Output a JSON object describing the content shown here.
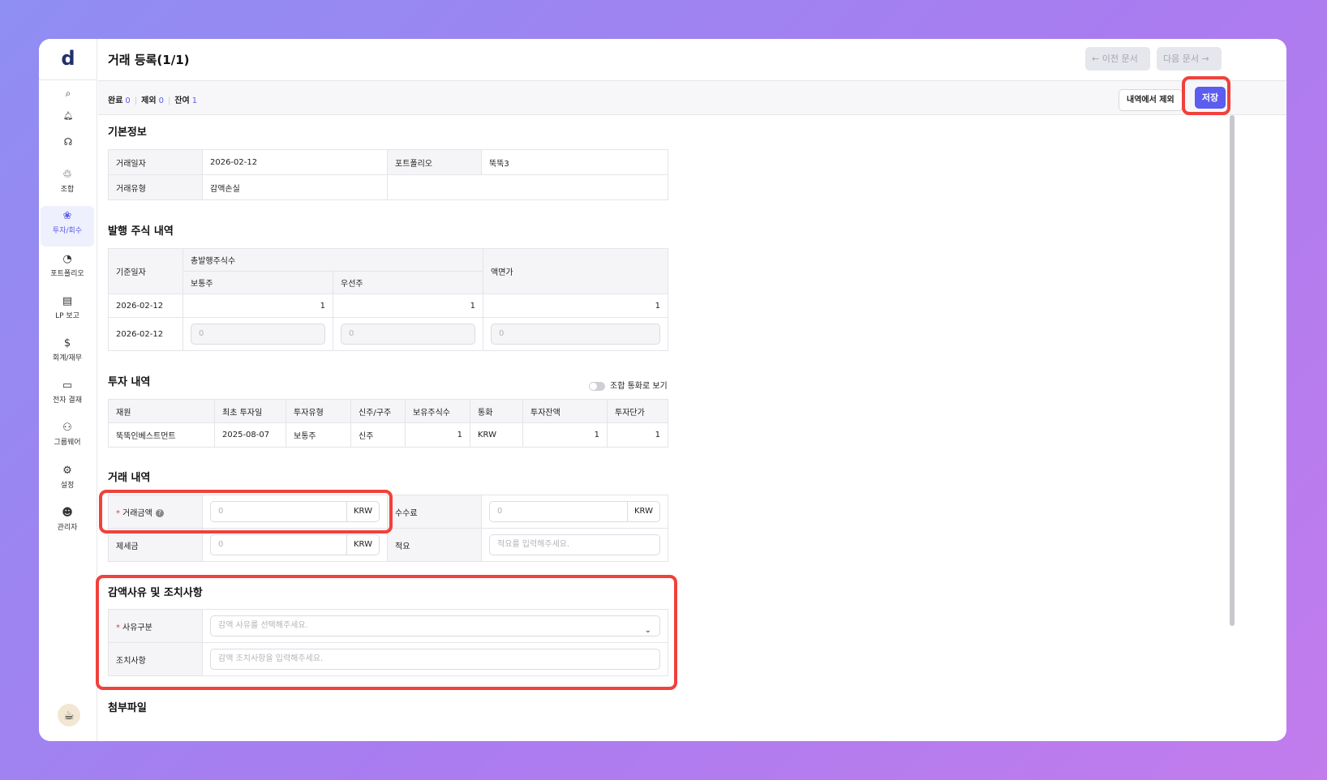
{
  "app": {
    "logo": "d",
    "avatar_icon": "☕"
  },
  "sidebar": {
    "top_icons": [
      {
        "name": "search-icon",
        "glyph": "⌕"
      },
      {
        "name": "bell-icon",
        "glyph": "🔔︎"
      },
      {
        "name": "headset-icon",
        "glyph": "☊"
      }
    ],
    "items": [
      {
        "label": "조합",
        "icon": "fund-icon",
        "glyph": "♲"
      },
      {
        "label": "투자/회수",
        "icon": "investment-icon",
        "glyph": "❀"
      },
      {
        "label": "포트폴리오",
        "icon": "portfolio-icon",
        "glyph": "◔"
      },
      {
        "label": "LP 보고",
        "icon": "report-icon",
        "glyph": "▤"
      },
      {
        "label": "회계/재무",
        "icon": "accounting-icon",
        "glyph": "$"
      },
      {
        "label": "전자 결재",
        "icon": "approval-icon",
        "glyph": "▭"
      },
      {
        "label": "그룹웨어",
        "icon": "groupware-icon",
        "glyph": "⚇"
      },
      {
        "label": "설정",
        "icon": "settings-icon",
        "glyph": "⚙"
      },
      {
        "label": "관리자",
        "icon": "admin-icon",
        "glyph": "☻"
      }
    ],
    "active_index": 1
  },
  "header": {
    "title": "거래 등록(1/1)",
    "prev_label": "← 이전 문서",
    "next_label": "다음 문서 →"
  },
  "counts": {
    "done_label": "완료",
    "done": "0",
    "excluded_label": "제외",
    "excluded": "0",
    "remaining_label": "잔여",
    "remaining": "1"
  },
  "actions": {
    "exclude_label": "내역에서 제외",
    "save_label": "저장"
  },
  "basic": {
    "title": "기본정보",
    "date_label": "거래일자",
    "date": "2026-02-12",
    "portfolio_label": "포트폴리오",
    "portfolio": "뚝뚝3",
    "type_label": "거래유형",
    "type": "감액손실"
  },
  "shares": {
    "title": "발행 주식 내역",
    "ref_date_label": "기준일자",
    "total_label": "총발행주식수",
    "common_label": "보통주",
    "preferred_label": "우선주",
    "par_label": "액면가",
    "row1": {
      "date": "2026-02-12",
      "common": "1",
      "preferred": "1",
      "par": "1"
    },
    "row2": {
      "date": "2026-02-12",
      "common_ph": "0",
      "preferred_ph": "0",
      "par_ph": "0"
    }
  },
  "invest": {
    "title": "투자 내역",
    "toggle_label": "조합 통화로 보기",
    "headers": [
      "재원",
      "최초 투자일",
      "투자유형",
      "신주/구주",
      "보유주식수",
      "통화",
      "투자잔액",
      "투자단가"
    ],
    "row": [
      "뚝뚝인베스트먼트",
      "2025-08-07",
      "보통주",
      "신주",
      "1",
      "KRW",
      "1",
      "1"
    ]
  },
  "trade": {
    "title": "거래 내역",
    "amount_label": "거래금액",
    "amount_ph": "0",
    "fee_label": "수수료",
    "fee_ph": "0",
    "tax_label": "제세금",
    "tax_ph": "0",
    "memo_label": "적요",
    "memo_ph": "적요를 입력해주세요.",
    "unit": "KRW"
  },
  "reason": {
    "title": "감액사유 및 조치사항",
    "reason_label": "사유구분",
    "reason_ph": "감액 사유를 선택해주세요.",
    "action_label": "조치사항",
    "action_ph": "감액 조치사항을 입력해주세요."
  },
  "attach": {
    "title": "첨부파일"
  },
  "colors": {
    "accent": "#5b5cf0",
    "highlight": "#f0413b"
  }
}
